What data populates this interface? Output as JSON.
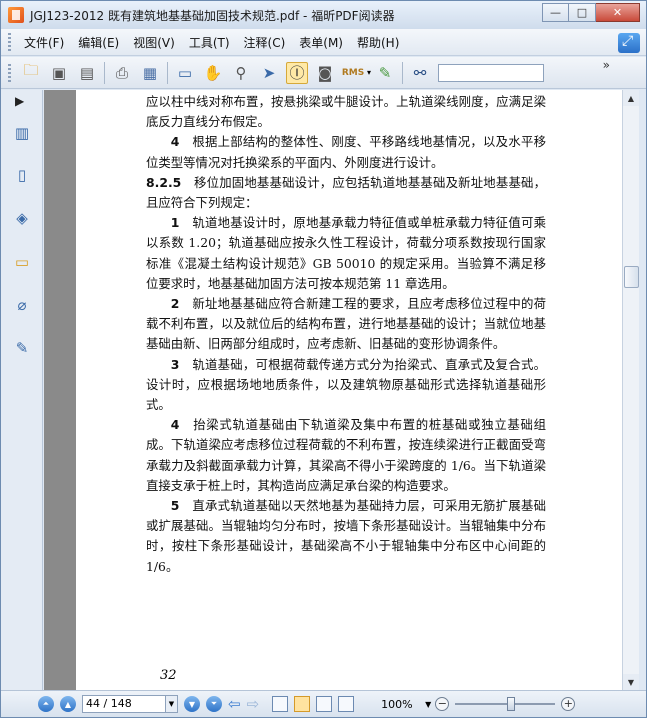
{
  "window": {
    "title": "JGJ123-2012 既有建筑地基基础加固技术规范.pdf - 福昕PDF阅读器",
    "controls": {
      "minimize": "—",
      "restore": "□",
      "close": "✕"
    }
  },
  "menubar": {
    "items": [
      "文件(F)",
      "编辑(E)",
      "视图(V)",
      "工具(T)",
      "注释(C)",
      "表单(M)",
      "帮助(H)"
    ]
  },
  "toolbar": {
    "icons": [
      "open-folder-icon",
      "save-icon",
      "save-all-icon",
      "print-icon",
      "scan-icon",
      "fullscreen-monitor-icon",
      "hand-tool-icon",
      "zoom-icon",
      "select-arrow-icon",
      "text-select-icon",
      "snapshot-icon",
      "rms-icon",
      "sign-icon",
      "find-binoculars-icon"
    ],
    "search_value": "",
    "more": "»"
  },
  "leftpanel": {
    "icons": [
      "bookmarks-icon",
      "pages-icon",
      "layers-icon",
      "comments-icon",
      "attachments-icon",
      "signature-icon"
    ]
  },
  "document": {
    "paragraphs": [
      {
        "indent": false,
        "num": "",
        "text": "应以柱中线对称布置，按悬挑梁或牛腿设计。上轨道梁线刚度，应满足梁底反力直线分布假定。"
      },
      {
        "indent": true,
        "num": "4",
        "text": "根据上部结构的整体性、刚度、平移路线地基情况，以及水平移位类型等情况对托换梁系的平面内、外刚度进行设计。"
      },
      {
        "indent": false,
        "num": "8.2.5",
        "text": "移位加固地基基础设计，应包括轨道地基基础及新址地基基础，且应符合下列规定："
      },
      {
        "indent": true,
        "num": "1",
        "text": "轨道地基设计时，原地基承载力特征值或单桩承载力特征值可乘以系数 1.20；轨道基础应按永久性工程设计，荷载分项系数按现行国家标准《混凝土结构设计规范》GB 50010 的规定采用。当验算不满足移位要求时，地基基础加固方法可按本规范第 11 章选用。"
      },
      {
        "indent": true,
        "num": "2",
        "text": "新址地基基础应符合新建工程的要求，且应考虑移位过程中的荷载不利布置，以及就位后的结构布置，进行地基基础的设计；当就位地基基础由新、旧两部分组成时，应考虑新、旧基础的变形协调条件。"
      },
      {
        "indent": true,
        "num": "3",
        "text": "轨道基础，可根据荷载传递方式分为抬梁式、直承式及复合式。设计时，应根据场地地质条件，以及建筑物原基础形式选择轨道基础形式。"
      },
      {
        "indent": true,
        "num": "4",
        "text": "抬梁式轨道基础由下轨道梁及集中布置的桩基础或独立基础组成。下轨道梁应考虑移位过程荷载的不利布置，按连续梁进行正截面受弯承载力及斜截面承载力计算，其梁高不得小于梁跨度的 1/6。当下轨道梁直接支承于桩上时，其构造尚应满足承台梁的构造要求。"
      },
      {
        "indent": true,
        "num": "5",
        "text": "直承式轨道基础以天然地基为基础持力层，可采用无筋扩展基础或扩展基础。当辊轴均匀分布时，按墙下条形基础设计。当辊轴集中分布时，按柱下条形基础设计，基础梁高不小于辊轴集中分布区中心间距的 1/6。"
      }
    ],
    "page_number_printed": "32"
  },
  "statusbar": {
    "page_field": "44 / 148",
    "zoom": "100%",
    "zoom_minus": "−",
    "zoom_plus": "+"
  },
  "colors": {
    "accent": "#2e73c7",
    "page_bg": "#ffffff",
    "doc_bg": "#8a8a8a"
  }
}
